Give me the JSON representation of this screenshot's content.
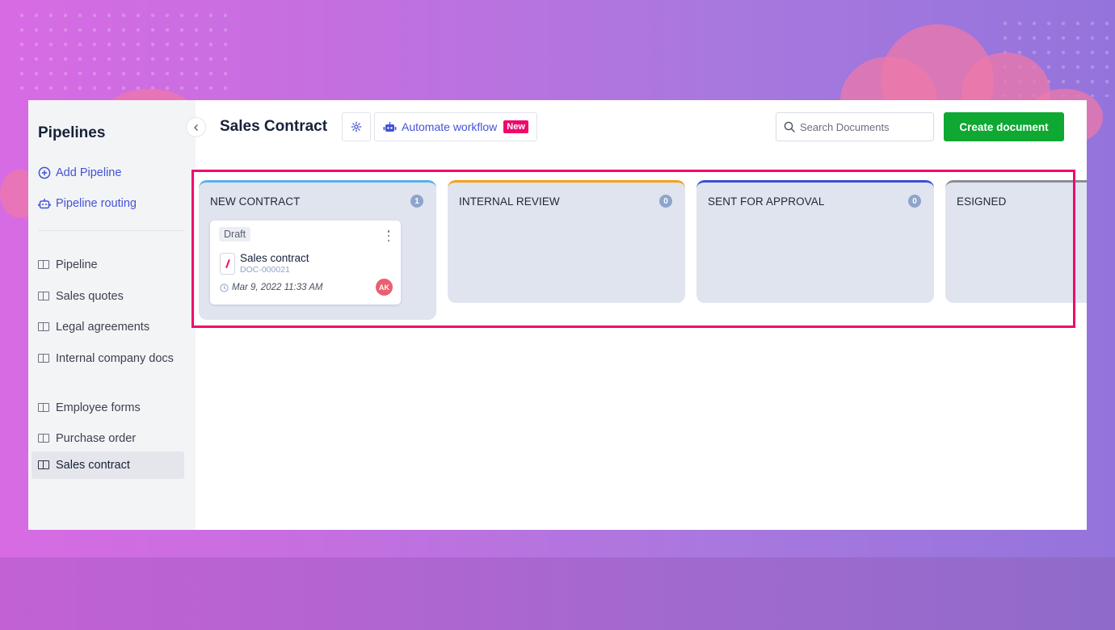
{
  "sidebar": {
    "title": "Pipelines",
    "actions": [
      {
        "label": "Add Pipeline",
        "icon": "plus-circle-icon"
      },
      {
        "label": "Pipeline routing",
        "icon": "robot-icon"
      }
    ],
    "items": [
      {
        "label": "Pipeline",
        "active": false
      },
      {
        "label": "Sales quotes",
        "active": false
      },
      {
        "label": "Legal agreements",
        "active": false
      },
      {
        "label": "Internal company docs",
        "active": false
      },
      {
        "label": "Employee forms",
        "active": false
      },
      {
        "label": "Purchase order",
        "active": false
      },
      {
        "label": "Sales contract",
        "active": true
      }
    ]
  },
  "header": {
    "title": "Sales Contract",
    "automate_label": "Automate workflow",
    "new_badge": "New",
    "search_placeholder": "Search Documents",
    "search_value": "",
    "create_label": "Create document"
  },
  "columns": [
    {
      "title": "NEW CONTRACT",
      "count": "1",
      "accent": "#5ab0e8"
    },
    {
      "title": "INTERNAL REVIEW",
      "count": "0",
      "accent": "#f5a01a"
    },
    {
      "title": "SENT FOR APPROVAL",
      "count": "0",
      "accent": "#3b4fd8"
    },
    {
      "title": "ESIGNED",
      "count": null,
      "accent": "#8a8d94"
    }
  ],
  "cards": [
    {
      "status": "Draft",
      "name": "Sales contract",
      "doc_id": "DOC-000021",
      "date": "Mar 9, 2022 11:33 AM",
      "assignee_initials": "AK"
    }
  ],
  "colors": {
    "brand_blue": "#4353d6",
    "create_green": "#0ea832",
    "highlight": "#f2076f",
    "new_badge": "#f0096c"
  }
}
